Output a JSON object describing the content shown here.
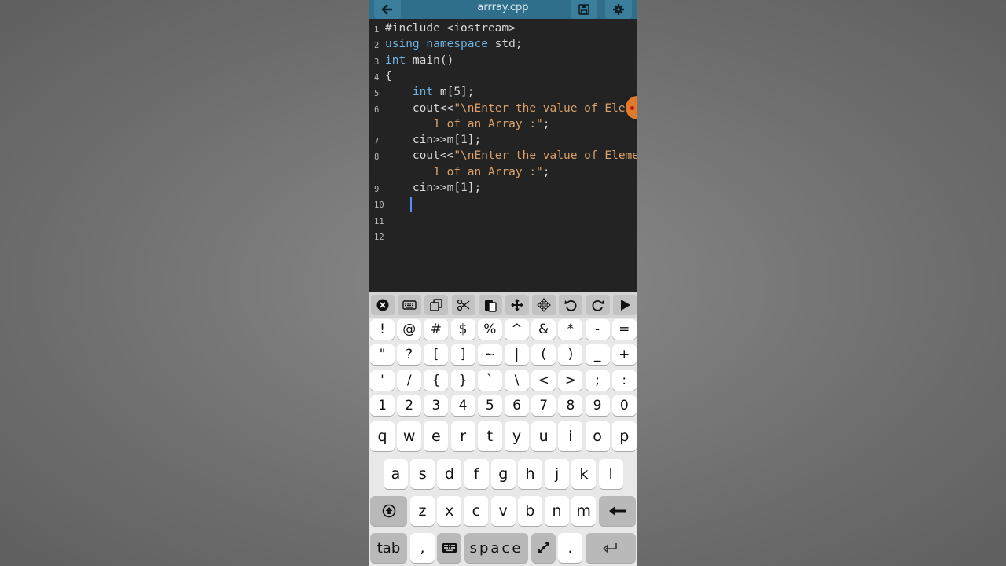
{
  "editor": {
    "filename": "arrray.cpp",
    "lines": [
      {
        "n": "1",
        "parts": [
          {
            "t": "#include <iostream>",
            "c": "plain"
          }
        ]
      },
      {
        "n": "2",
        "parts": [
          {
            "t": "using namespace",
            "c": "kw"
          },
          {
            "t": " std;",
            "c": "plain"
          }
        ]
      },
      {
        "n": "3",
        "parts": [
          {
            "t": "int",
            "c": "kw"
          },
          {
            "t": " main()",
            "c": "plain"
          }
        ]
      },
      {
        "n": "4",
        "parts": [
          {
            "t": "{",
            "c": "plain"
          }
        ]
      },
      {
        "n": "5",
        "parts": [
          {
            "t": "    ",
            "c": "plain"
          },
          {
            "t": "int",
            "c": "kw"
          },
          {
            "t": " m[5];",
            "c": "plain"
          }
        ]
      },
      {
        "n": "6",
        "parts": [
          {
            "t": "    cout<<",
            "c": "plain"
          },
          {
            "t": "\"\\nEnter the value of Element",
            "c": "str"
          }
        ]
      },
      {
        "n": "",
        "parts": [
          {
            "t": "       1 of an Array :\"",
            "c": "str"
          },
          {
            "t": ";",
            "c": "plain"
          }
        ]
      },
      {
        "n": "7",
        "parts": [
          {
            "t": "    cin>>m[1];",
            "c": "plain"
          }
        ]
      },
      {
        "n": "8",
        "parts": [
          {
            "t": "    cout<<",
            "c": "plain"
          },
          {
            "t": "\"\\nEnter the value of Element",
            "c": "str"
          }
        ]
      },
      {
        "n": "",
        "parts": [
          {
            "t": "       1 of an Array :\"",
            "c": "str"
          },
          {
            "t": ";",
            "c": "plain"
          }
        ]
      },
      {
        "n": "9",
        "parts": [
          {
            "t": "    cin>>m[1];",
            "c": "plain"
          }
        ]
      },
      {
        "n": "10",
        "parts": []
      },
      {
        "n": "11",
        "parts": []
      },
      {
        "n": "12",
        "parts": []
      }
    ]
  },
  "toolbar_icons": [
    "close-icon",
    "keyboard-icon",
    "copy-icon",
    "cut-icon",
    "paste-icon",
    "move-cursor-icon",
    "select-move-icon",
    "undo-icon",
    "redo-icon",
    "run-icon"
  ],
  "keyboard": {
    "row1": [
      "!",
      "@",
      "#",
      "$",
      "%",
      "^",
      "&",
      "*",
      "-",
      "="
    ],
    "row2": [
      "\"",
      "?",
      "[",
      "]",
      "~",
      "|",
      "(",
      ")",
      "_",
      "+"
    ],
    "row3": [
      "'",
      "/",
      "{",
      "}",
      "`",
      "\\",
      "<",
      ">",
      ";",
      ":"
    ],
    "row4": [
      "1",
      "2",
      "3",
      "4",
      "5",
      "6",
      "7",
      "8",
      "9",
      "0"
    ],
    "row5": [
      "q",
      "w",
      "e",
      "r",
      "t",
      "y",
      "u",
      "i",
      "o",
      "p"
    ],
    "row6": [
      "a",
      "s",
      "d",
      "f",
      "g",
      "h",
      "j",
      "k",
      "l"
    ],
    "row7": [
      "z",
      "x",
      "c",
      "v",
      "b",
      "n",
      "m"
    ],
    "tab": "tab",
    "comma": ",",
    "space": "space",
    "period": "."
  },
  "colors": {
    "titlebar": "#2f6f8b",
    "editor_bg": "#232323",
    "keyword": "#6fb3e0",
    "string": "#d9a06b"
  }
}
